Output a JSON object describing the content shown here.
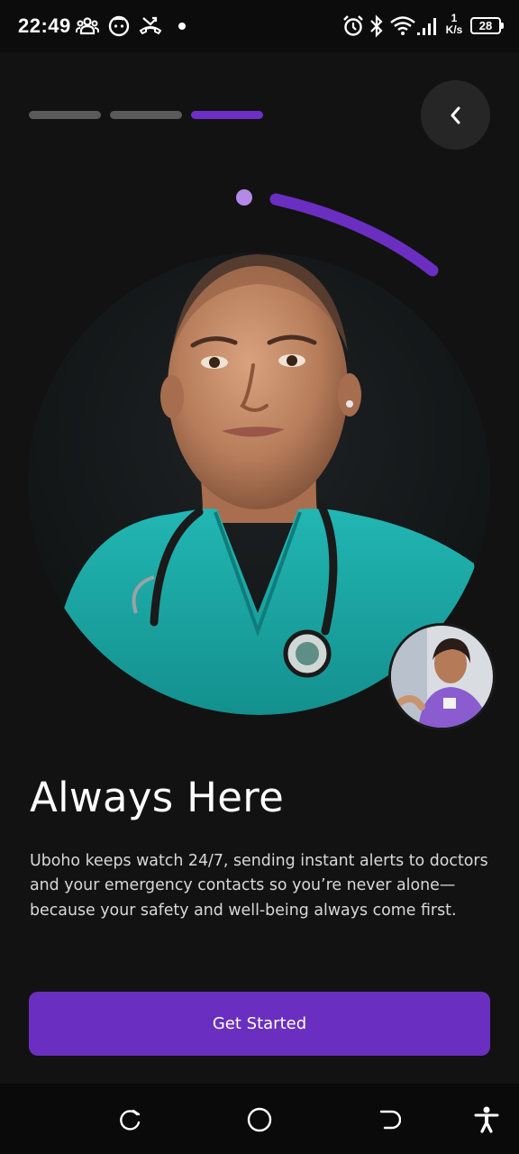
{
  "status_bar": {
    "time": "22:49",
    "network_speed_value": "1",
    "network_speed_unit": "K/s",
    "battery_level": "28",
    "icons": [
      "people-icon",
      "face-icon",
      "missed-call-icon",
      "notification-dot",
      "alarm-icon",
      "bluetooth-icon",
      "wifi-icon",
      "signal-icon",
      "battery-icon"
    ]
  },
  "onboarding": {
    "steps_total": 3,
    "current_step": 3,
    "back_icon": "chevron-left-icon"
  },
  "hero": {
    "main_photo": "nurse-portrait",
    "secondary_photo": "nurse-with-patient"
  },
  "content": {
    "title": "Always Here",
    "description": "Uboho keeps watch 24/7, sending instant alerts to doctors and your emergency contacts so you’re never alone—because your safety and well-being always come first."
  },
  "actions": {
    "get_started_label": "Get Started"
  },
  "nav_bar": {
    "icons": [
      "recents-icon",
      "home-icon",
      "back-icon",
      "accessibility-icon"
    ]
  },
  "colors": {
    "background": "#121212",
    "accent": "#6a2fc0",
    "progress_inactive": "#5a5a5a",
    "text_primary": "#ffffff",
    "text_secondary": "#d8d8d8"
  }
}
